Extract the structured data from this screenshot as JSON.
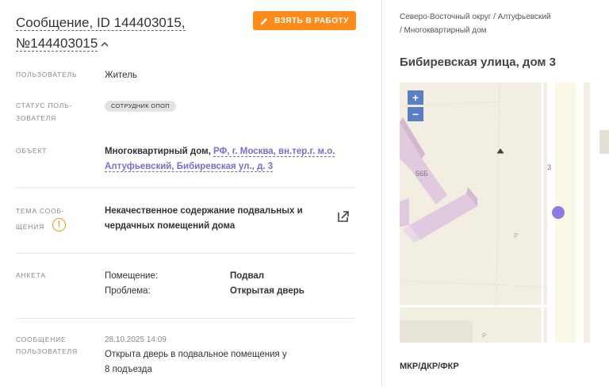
{
  "header": {
    "title_line1": "Сообщение, ID 144403015,",
    "title_line2": "№144403015",
    "take_button": "ВЗЯТЬ В РАБОТУ"
  },
  "fields": {
    "user_label": "ПОЛЬЗОВАТЕЛЬ",
    "user_value": "Житель",
    "status_label_1": "СТАТУС ПОЛЬ-",
    "status_label_2": "ЗОВАТЕЛЯ",
    "status_value": "СОТРУДНИК ОПОП",
    "object_label": "ОБЪЕКТ",
    "object_prefix": "Многоквартирный дом, ",
    "object_link_1": "РФ, г. Москва, вн.тер.г. м.о.",
    "object_link_2": "Алтуфьевский, Бибиревская ул., д. 3",
    "topic_label_1": "ТЕМА СООБ-",
    "topic_label_2": "ЩЕНИЯ",
    "warn_glyph": "!",
    "topic_value_1": "Некачественное содержание подвальных и",
    "topic_value_2": "чердачных помещений дома",
    "anketa_label": "АНКЕТА",
    "anketa_rows": [
      {
        "key": "Помещение:",
        "value": "Подвал"
      },
      {
        "key": "Проблема:",
        "value": "Открытая дверь"
      }
    ],
    "message_label_1": "СООБЩЕНИЕ",
    "message_label_2": "ПОЛЬЗОВАТЕЛЯ",
    "message_time": "28.10.2025 14:09",
    "message_text_1": "Открыта дверь в подвальное помещения у",
    "message_text_2": "8 подъезда"
  },
  "location": {
    "breadcrumb_1": "Северо-Восточный округ / Алтуфьевский",
    "breadcrumb_2": "/ Многоквартирный дом",
    "address": "Бибиревская улица, дом 3",
    "zoom_in": "+",
    "zoom_out": "−",
    "map_label_building": "56Б",
    "map_label_house": "3",
    "map_parking": "P",
    "mkr_label": "МКР/ДКР/ФКР"
  },
  "colors": {
    "accent": "#ff8c1a",
    "link": "#7b6cd8",
    "marker": "#8e7ae6",
    "zoom": "#5b7ec7",
    "warning": "#f39c12"
  }
}
